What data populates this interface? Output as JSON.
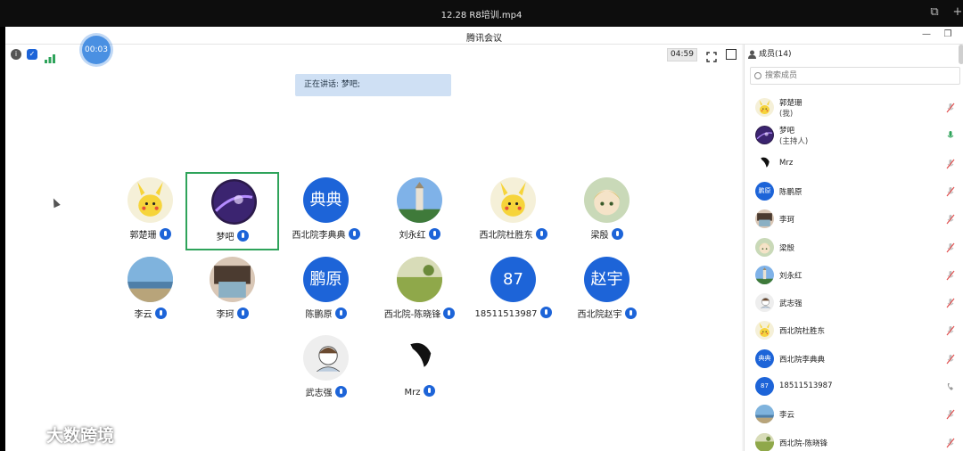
{
  "player": {
    "title": "12.28  R8培训.mp4"
  },
  "window": {
    "title": "腾讯会议"
  },
  "toolbar": {
    "timer": "00:03",
    "duration": "04:59"
  },
  "speaking": {
    "text": "正在讲话: 梦吧;"
  },
  "tiles": [
    {
      "name": "郭楚珊",
      "avatar_type": "pikachu"
    },
    {
      "name": "梦吧",
      "avatar_type": "galaxy",
      "active": true
    },
    {
      "name": "西北院李典典",
      "avatar_type": "letter",
      "letter": "典典"
    },
    {
      "name": "刘永红",
      "avatar_type": "pagoda"
    },
    {
      "name": "西北院杜胜东",
      "avatar_type": "pikachu"
    },
    {
      "name": "梁殷",
      "avatar_type": "anime"
    },
    {
      "name": "李云",
      "avatar_type": "beach"
    },
    {
      "name": "李珂",
      "avatar_type": "photo"
    },
    {
      "name": "陈鹏原",
      "avatar_type": "letter",
      "letter": "鹏原"
    },
    {
      "name": "西北院-陈晓锋",
      "avatar_type": "field"
    },
    {
      "name": "18511513987",
      "avatar_type": "letter",
      "letter": "87",
      "phone": true
    },
    {
      "name": "西北院赵宇",
      "avatar_type": "letter",
      "letter": "赵宇"
    },
    {
      "name": "武志强",
      "avatar_type": "sketch"
    },
    {
      "name": "Mrz",
      "avatar_type": "blot"
    }
  ],
  "members": {
    "header": "成员(14)",
    "search_placeholder": "搜索成员",
    "list": [
      {
        "name": "郭楚珊",
        "sub": "(我)",
        "avatar_type": "pikachu"
      },
      {
        "name": "梦吧",
        "sub": "(主持人)",
        "avatar_type": "galaxy",
        "mic_on": true
      },
      {
        "name": "Mrz",
        "avatar_type": "blot"
      },
      {
        "name": "陈鹏原",
        "avatar_type": "letter",
        "letter": "鹏原"
      },
      {
        "name": "李珂",
        "avatar_type": "photo"
      },
      {
        "name": "梁殷",
        "avatar_type": "anime"
      },
      {
        "name": "刘永红",
        "avatar_type": "pagoda"
      },
      {
        "name": "武志强",
        "avatar_type": "sketch"
      },
      {
        "name": "西北院杜胜东",
        "avatar_type": "pikachu"
      },
      {
        "name": "西北院李典典",
        "avatar_type": "letter",
        "letter": "典典"
      },
      {
        "name": "18511513987",
        "avatar_type": "letter",
        "letter": "87",
        "phone": true
      },
      {
        "name": "李云",
        "avatar_type": "beach"
      },
      {
        "name": "西北院-陈晓锋",
        "avatar_type": "field"
      }
    ]
  },
  "watermark": {
    "text": "大数跨境"
  },
  "colors": {
    "accent": "#1d64d8",
    "active_border": "#2ea35a",
    "speaking_bg": "#cfe0f4",
    "timer": "#4a90e2"
  }
}
